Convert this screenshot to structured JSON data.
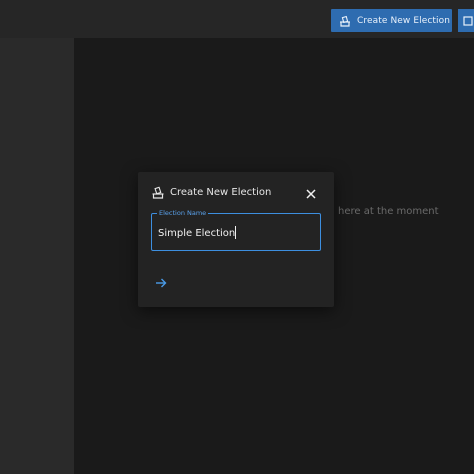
{
  "header": {
    "create_election_label": "Create New Election",
    "icons": {
      "create": "ballot-box-icon",
      "extra": "ballot-box-icon"
    }
  },
  "main": {
    "empty_message": "here at the moment"
  },
  "dialog": {
    "title": "Create New Election",
    "title_icon": "ballot-box-icon",
    "close_icon": "close-icon",
    "field_label": "Election Name",
    "field_value": "Simple Election",
    "submit_icon": "arrow-right-icon"
  },
  "colors": {
    "accent": "#2e6cb0",
    "field_border": "#3d8fe0",
    "background": "#1a1a1a",
    "sidebar": "#2a2a2a",
    "dialog": "#232323"
  }
}
